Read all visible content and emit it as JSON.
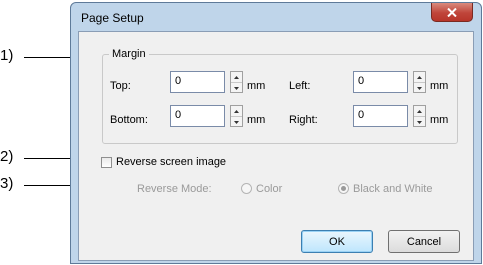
{
  "callouts": [
    "1)",
    "2)",
    "3)"
  ],
  "dialog": {
    "title": "Page Setup",
    "close_icon": "close-icon"
  },
  "margin": {
    "group_label": "Margin",
    "top_label": "Top:",
    "top_value": "0",
    "bottom_label": "Bottom:",
    "bottom_value": "0",
    "left_label": "Left:",
    "left_value": "0",
    "right_label": "Right:",
    "right_value": "0",
    "unit": "mm"
  },
  "reverse": {
    "checkbox_label": "Reverse screen image",
    "checked": false,
    "mode_label": "Reverse Mode:",
    "option_color": "Color",
    "option_bw": "Black and White",
    "selected": "Black and White"
  },
  "buttons": {
    "ok": "OK",
    "cancel": "Cancel"
  },
  "colors": {
    "frame": "#bfd5ea",
    "close": "#c0453a",
    "disabled_text": "#9a9a9a"
  }
}
